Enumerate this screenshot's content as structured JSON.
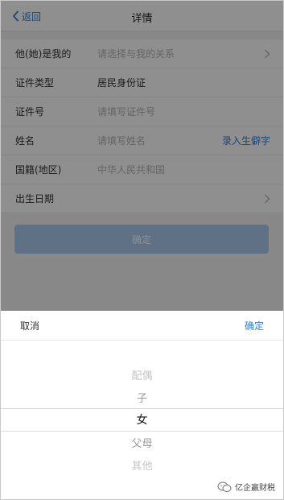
{
  "navbar": {
    "back_label": "返回",
    "title": "详情"
  },
  "form": {
    "rows": [
      {
        "label": "他(她)是我的",
        "placeholder": "请选择与我的关系"
      },
      {
        "label": "证件类型",
        "value": "居民身份证"
      },
      {
        "label": "证件号",
        "placeholder": "请填写证件号"
      },
      {
        "label": "姓名",
        "placeholder": "请填写姓名",
        "action": "录入生僻字"
      },
      {
        "label": "国籍(地区)",
        "placeholder": "中华人民共和国"
      },
      {
        "label": "出生日期"
      }
    ],
    "confirm_label": "确定"
  },
  "picker": {
    "cancel_label": "取消",
    "ok_label": "确定",
    "options": [
      "配偶",
      "子",
      "女",
      "父母",
      "其他"
    ],
    "selected_option": "女"
  },
  "watermark": {
    "text": "亿企赢财税"
  },
  "colors": {
    "accent": "#2f7cd9",
    "button_disabled": "#a9c9ee"
  }
}
